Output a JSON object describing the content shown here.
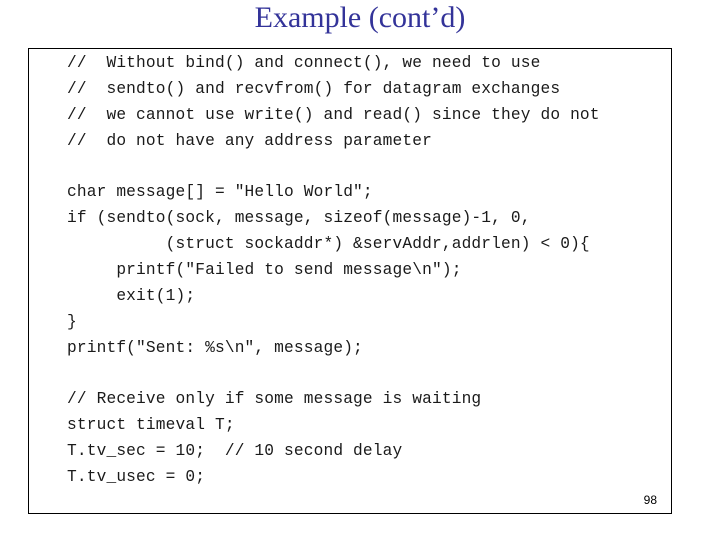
{
  "slide": {
    "title": "Example (cont’d)",
    "page_number": "98"
  },
  "code": {
    "comment_block": [
      "//  Without bind() and connect(), we need to use",
      "//  sendto() and recvfrom() for datagram exchanges",
      "//  we cannot use write() and read() since they do not",
      "//  do not have any address parameter"
    ],
    "send_block": [
      "char message[] = \"Hello World\";",
      "if (sendto(sock, message, sizeof(message)-1, 0,",
      "          (struct sockaddr*) &servAddr,addrlen) < 0){",
      "     printf(\"Failed to send message\\n\");",
      "     exit(1);",
      "}",
      "printf(\"Sent: %s\\n\", message);"
    ],
    "receive_block": [
      "// Receive only if some message is waiting",
      "struct timeval T;",
      "T.tv_sec = 10;  // 10 second delay",
      "T.tv_usec = 0;"
    ]
  }
}
